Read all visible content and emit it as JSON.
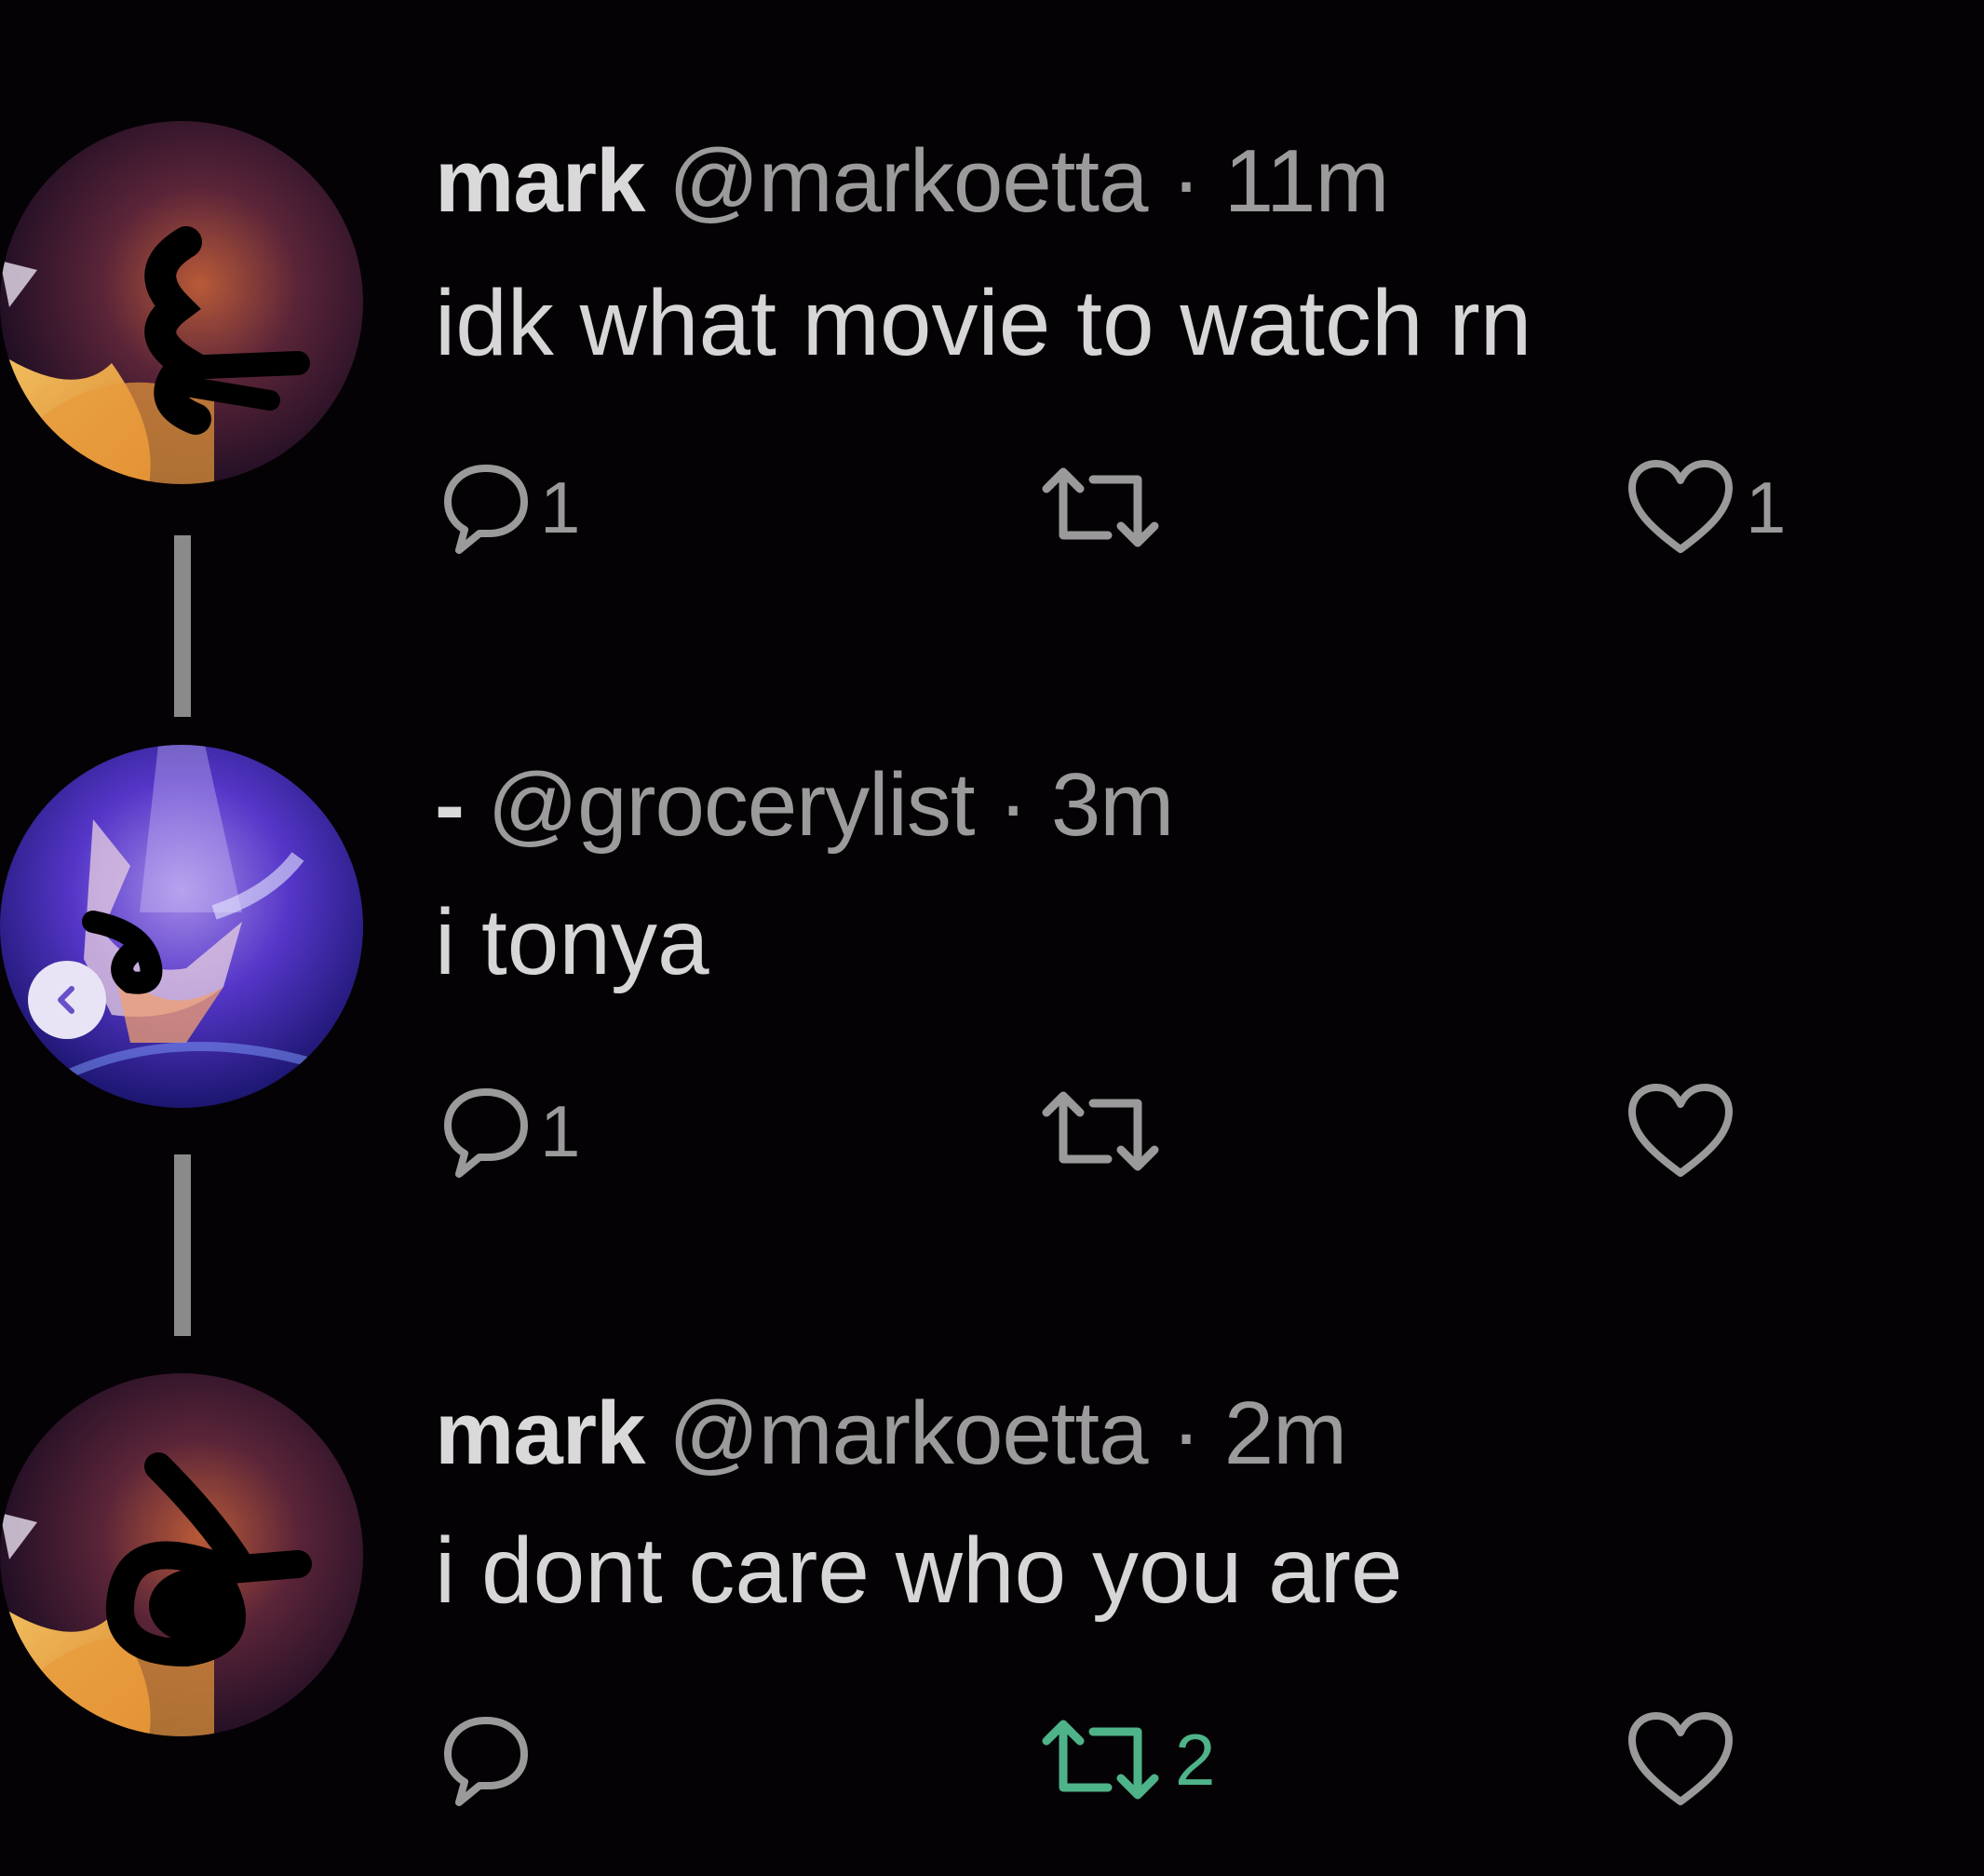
{
  "thread": [
    {
      "name": "mark",
      "handle": "@markoetta",
      "separator": "·",
      "time": "11m",
      "text": "idk what movie to watch rn",
      "reply_count": "1",
      "retweet_count": "",
      "like_count": "1",
      "retweeted": false
    },
    {
      "name": "-",
      "handle": "@grocerylist",
      "separator": "·",
      "time": "3m",
      "text": "i tonya",
      "reply_count": "1",
      "retweet_count": "",
      "like_count": "",
      "retweeted": false
    },
    {
      "name": "mark",
      "handle": "@markoetta",
      "separator": "·",
      "time": "2m",
      "text": "i dont care who you are",
      "reply_count": "",
      "retweet_count": "2",
      "like_count": "",
      "retweeted": true
    }
  ],
  "icons": {
    "reply": "reply-icon",
    "retweet": "retweet-icon",
    "like": "heart-icon",
    "back": "chevron-left-icon"
  },
  "colors": {
    "background": "#050205",
    "text_primary": "#d6d6d6",
    "text_secondary": "#9b9b9b",
    "retweet_active": "#4fb389",
    "back_button": "#e8e4f6"
  }
}
